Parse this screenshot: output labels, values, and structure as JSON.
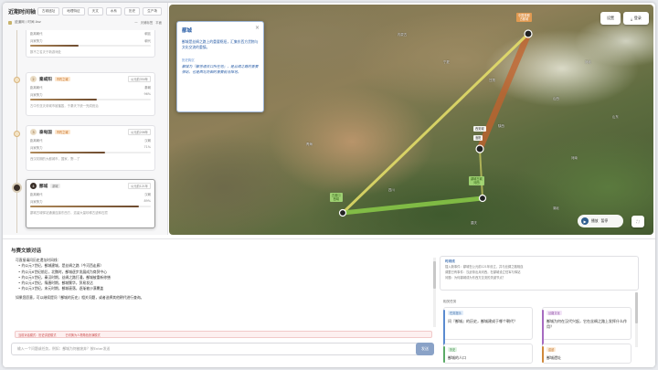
{
  "app": {
    "title": "近期时间轴",
    "filters": [
      "古城遗址",
      "地理特征",
      "天文",
      "水系",
      "历史",
      "生产场"
    ],
    "location_label": "迹道网 / 时间 Asz",
    "view_buttons": [
      "一",
      "天辅标签",
      "平面"
    ]
  },
  "timeline": {
    "items": [
      {
        "num": "",
        "name": "",
        "tag": "",
        "pill": "",
        "stat_label": "距离朝代",
        "stat_value": "朝廷",
        "stat2_label": "兵家势力",
        "stat2_value": "朝代",
        "progress": 0.4,
        "note": "数不之名灭于新游戏处"
      },
      {
        "num": "2",
        "name": "秦咸阳",
        "tag": "不朽之城",
        "pill": "公元前350年",
        "stat_label": "距离朝代",
        "stat_value": "秦朝",
        "stat2_label": "兵家势力",
        "stat2_value": "96%",
        "progress": 0.55,
        "note": "古中东亚灭帝城市被摧毁，于秦天下统一完成统治"
      },
      {
        "num": "3",
        "name": "泰甸国",
        "tag": "不朽之城",
        "pill": "公元前206年",
        "stat_label": "距离朝代",
        "stat_value": "汉朝",
        "stat2_label": "兵家势力",
        "stat2_value": "71%",
        "progress": 0.62,
        "note": "西汉初期的大都城市，国家，野…了"
      },
      {
        "num": "4",
        "name": "鄯城",
        "tag": "鄯城",
        "pill": "公元前121年",
        "stat_label": "距离朝代",
        "stat_value": "汉朝",
        "stat2_label": "兵家势力",
        "stat2_value": "89%",
        "progress": 0.9,
        "note": "鄯城古城驿站通道连接东西方，遗留大量珍稀古迹和石窟"
      }
    ]
  },
  "map": {
    "popup": {
      "title": "鄯城",
      "close": "×",
      "desc": "鄯城是丝绸之路上的重要枢纽，汇集东西方货物与文化交流的重镇。",
      "section": "历史钩沉",
      "quote": "鄯城为『鄯善通关口所在地』，是丝绸之路的重要驿站，也是西北防御的重要前沿阵地。"
    },
    "points": [
      {
        "name": "中国首都",
        "sub": "古都城"
      },
      {
        "name": "洛阳",
        "sub": ""
      },
      {
        "name": "西安城",
        "sub": ""
      },
      {
        "name": "鄯城古城",
        "sub": "河西"
      },
      {
        "name": "古渡口",
        "sub": "西域"
      }
    ],
    "top_btn1": "设置",
    "top_btn2": "登录",
    "play_label": "播放",
    "play_sub": "暂停",
    "labels": [
      "甘肃",
      "宁夏",
      "陕西",
      "山西",
      "河南",
      "河北",
      "四川",
      "青海",
      "湖北",
      "重庆",
      "内蒙古",
      "山东"
    ]
  },
  "chat": {
    "title": "与赛文娘对话",
    "message_intro": "可直接请问历史遗址时间线：",
    "message_items": [
      "约公元7世纪，鄯城建城，是丝绸之路（今河西走廊）",
      "约公元6世纪前后，北魏时，鄯城逐步发展成为商贸中心",
      "约公元5世纪，秦汉时期，丝绸之路打通，鄯城被重新修缮",
      "约公元4世纪，隋唐时期，鄯城繁华，贸易发达",
      "约公元3世纪，宋元时期，鄯城衰落，逐渐被沙漠覆盖"
    ],
    "message_outro": "如果您愿意，可以继续提问『鄯城的历史』相关问题，或者选择其他朝代进行查询。",
    "status_items": [
      "当前对话模式：历史讲述模式",
      "已切换为人物角色扮演模式"
    ],
    "input_placeholder": "输入一个问题或任务，例如：鄯城为何被废弃？按Enter发送",
    "send_label": "发送"
  },
  "side": {
    "header": "时间线",
    "lines": [
      "插入新事件：鄯城在公元前121年设立，并与丝绸之路相连",
      "调整已有事件：汉武帝出兵河西，在鄯城设立驻军与驿站",
      "问题：为何鄯城成为东西方交流的关键节点？"
    ],
    "tasks_title": "相关任务",
    "tasks": [
      {
        "tag": "任务提示",
        "text": "问『鄯城』的历史，鄯城建成于哪个朝代？"
      },
      {
        "tag": "丝路文化",
        "text": "鄯城为何在汉代兴起，它在丝绸之路上发挥什么作用？"
      },
      {
        "tag": "历史",
        "text": "鄯城的人口"
      },
      {
        "tag": "遗迹",
        "text": "鄯城遗址"
      }
    ]
  },
  "colors": {
    "route_orange": "#c4612c",
    "route_yellow": "#e7e26a",
    "route_green": "#8fd24a",
    "accent_blue": "#2b5fa8"
  }
}
